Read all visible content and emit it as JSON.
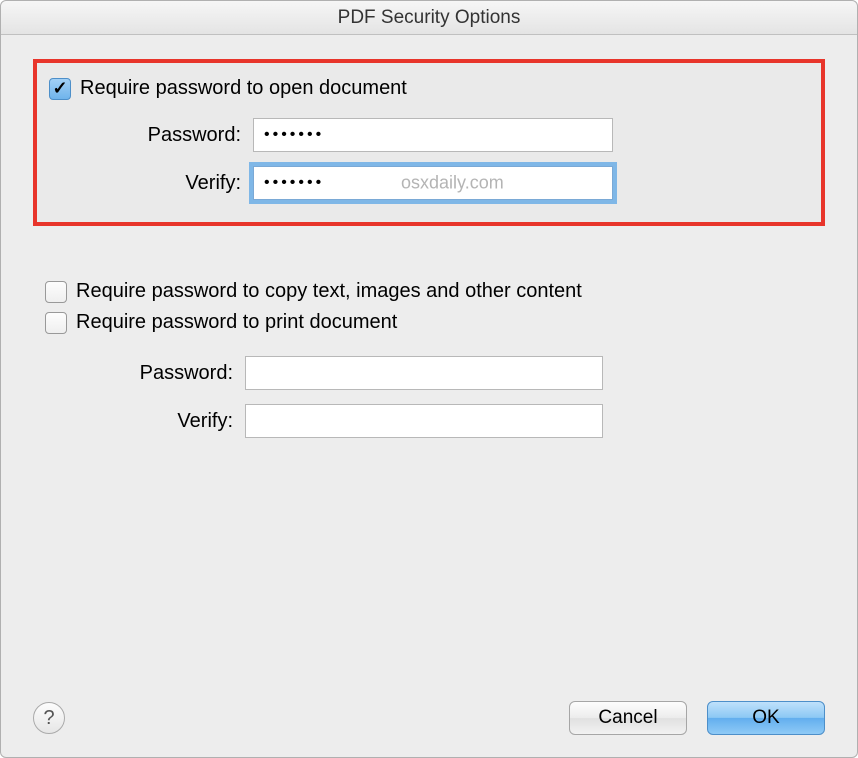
{
  "dialog": {
    "title": "PDF Security Options"
  },
  "section_open": {
    "checkbox_label": "Require password to open document",
    "checked": true,
    "password_label": "Password:",
    "password_value": "•••••••",
    "verify_label": "Verify:",
    "verify_value": "•••••••",
    "watermark": "osxdaily.com"
  },
  "section_perm": {
    "checkbox_copy_label": "Require password to copy text, images and other content",
    "checkbox_copy_checked": false,
    "checkbox_print_label": "Require password to print document",
    "checkbox_print_checked": false,
    "password_label": "Password:",
    "password_value": "",
    "verify_label": "Verify:",
    "verify_value": ""
  },
  "footer": {
    "help": "?",
    "cancel": "Cancel",
    "ok": "OK"
  }
}
